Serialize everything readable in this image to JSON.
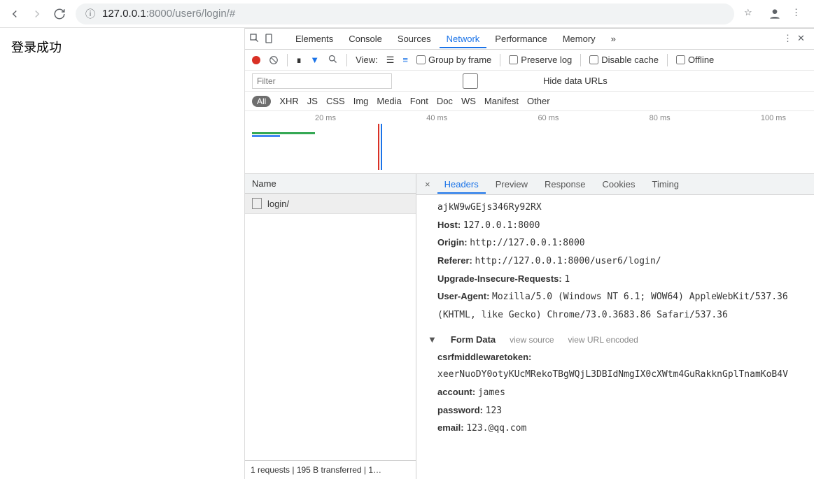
{
  "url": {
    "host": "127.0.0.1",
    "port": ":8000",
    "path": "/user6/login/#"
  },
  "page_text": "登录成功",
  "devtools_tabs": [
    "Elements",
    "Console",
    "Sources",
    "Network",
    "Performance",
    "Memory"
  ],
  "devtools_active_tab": "Network",
  "toolbar": {
    "view_label": "View:",
    "group_by_frame": "Group by frame",
    "preserve_log": "Preserve log",
    "disable_cache": "Disable cache",
    "offline": "Offline"
  },
  "filter": {
    "placeholder": "Filter",
    "hide_data_urls": "Hide data URLs"
  },
  "types": [
    "All",
    "XHR",
    "JS",
    "CSS",
    "Img",
    "Media",
    "Font",
    "Doc",
    "WS",
    "Manifest",
    "Other"
  ],
  "timeline_ticks": [
    "20 ms",
    "40 ms",
    "60 ms",
    "80 ms",
    "100 ms"
  ],
  "requests": {
    "header": "Name",
    "items": [
      "login/"
    ],
    "summary": "1 requests  |  195 B transferred  |  1…"
  },
  "detail_tabs": [
    "Headers",
    "Preview",
    "Response",
    "Cookies",
    "Timing"
  ],
  "detail_active": "Headers",
  "headers": {
    "cookie_fragment": "ajkW9wGEjs346Ry92RX",
    "Host": "127.0.0.1:8000",
    "Origin": "http://127.0.0.1:8000",
    "Referer": "http://127.0.0.1:8000/user6/login/",
    "Upgrade-Insecure-Requests": "1",
    "User-Agent": "Mozilla/5.0 (Windows NT 6.1; WOW64) AppleWebKit/537.36 (KHTML, like Gecko) Chrome/73.0.3683.86 Safari/537.36"
  },
  "form_section": {
    "title": "Form Data",
    "view_source": "view source",
    "view_url_encoded": "view URL encoded"
  },
  "form_data": {
    "csrfmiddlewaretoken": "xeerNuoDY0otyKUcMRekoTBgWQjL3DBIdNmgIX0cXWtm4GuRakknGplTnamKoB4V",
    "account": "james",
    "password": "123",
    "email": "123.@qq.com"
  }
}
